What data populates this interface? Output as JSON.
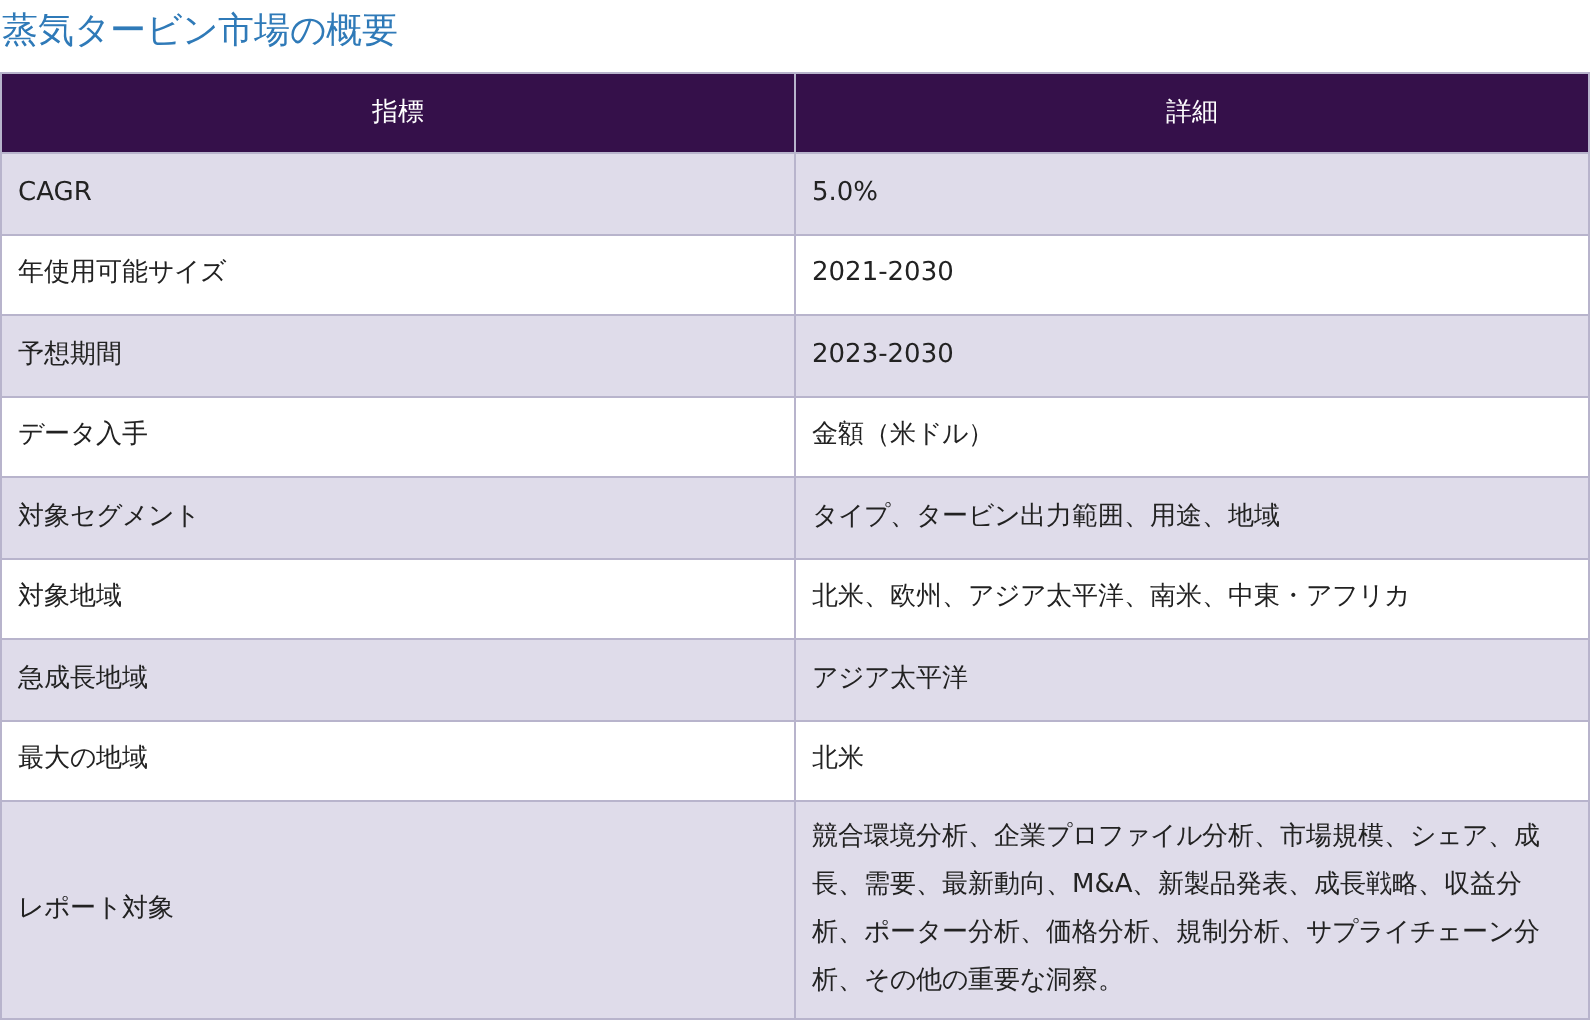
{
  "title": "蒸気タービン市場の概要",
  "table": {
    "columns": [
      "指標",
      "詳細"
    ],
    "rows": [
      {
        "cells": [
          "CAGR",
          "5.0%"
        ]
      },
      {
        "cells": [
          "年使用可能サイズ",
          "2021-2030"
        ]
      },
      {
        "cells": [
          "予想期間",
          "2023-2030"
        ]
      },
      {
        "cells": [
          "データ入手",
          "金額（米ドル）"
        ]
      },
      {
        "cells": [
          "対象セグメント",
          "タイプ、タービン出力範囲、用途、地域"
        ]
      },
      {
        "cells": [
          "対象地域",
          "北米、欧州、アジア太平洋、南米、中東・アフリカ"
        ]
      },
      {
        "cells": [
          "急成長地域",
          "アジア太平洋"
        ]
      },
      {
        "cells": [
          "最大の地域",
          "北米"
        ]
      },
      {
        "cells": [
          "レポート対象",
          "競合環境分析、企業プロファイル分析、市場規模、シェア、成長、需要、最新動向、M&A、新製品発表、成長戦略、収益分析、ポーター分析、価格分析、規制分析、サプライチェーン分析、その他の重要な洞察。"
        ]
      }
    ]
  }
}
